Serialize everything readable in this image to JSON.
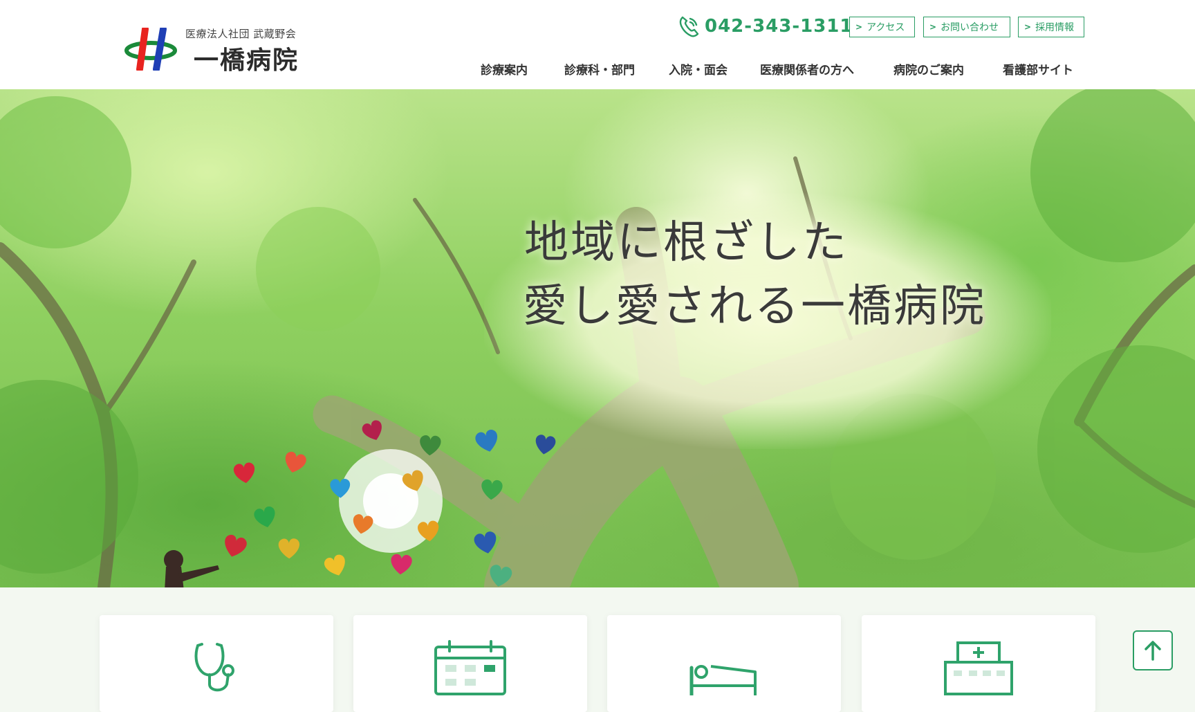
{
  "header": {
    "logo": {
      "subtitle": "医療法人社団 武蔵野会",
      "name": "一橋病院",
      "mark_colors": [
        "#e8231f",
        "#1b8a3a",
        "#1f3fb5"
      ]
    },
    "phone": "042-343-1311",
    "util_links": [
      {
        "label": "アクセス"
      },
      {
        "label": "お問い合わせ"
      },
      {
        "label": "採用情報"
      }
    ],
    "nav": [
      {
        "label": "診療案内"
      },
      {
        "label": "診療科・部門"
      },
      {
        "label": "入院・面会"
      },
      {
        "label": "医療関係者の方へ"
      },
      {
        "label": "病院のご案内"
      },
      {
        "label": "看護部サイト"
      }
    ]
  },
  "hero": {
    "line1": "地域に根ざした",
    "line2": "愛し愛される一橋病院",
    "heart_colors": [
      "#b3204c",
      "#3e8a3c",
      "#2a7ac2",
      "#2a4c9a",
      "#d8273a",
      "#e8553a",
      "#2a9ad8",
      "#e0a32a",
      "#3aa84a",
      "#2aa84a",
      "#e87a2a",
      "#e8a020",
      "#d02a3a",
      "#e0b22a",
      "#f0c02a",
      "#d82a6a",
      "#2a5ab0",
      "#4cb080"
    ]
  },
  "cards": [
    {
      "icon": "stethoscope-icon"
    },
    {
      "icon": "calendar-icon"
    },
    {
      "icon": "hospital-bed-icon"
    },
    {
      "icon": "hospital-building-icon"
    }
  ],
  "colors": {
    "accent": "#2a9d64",
    "icon": "#2fa36b"
  }
}
